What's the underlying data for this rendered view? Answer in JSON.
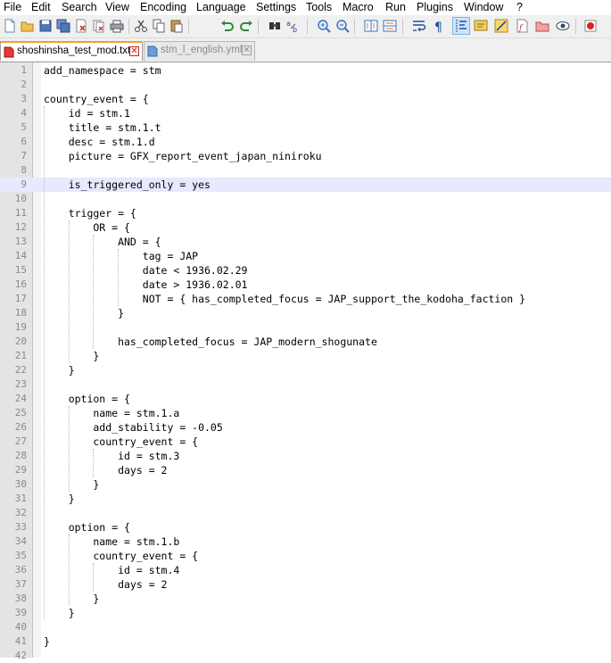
{
  "menu": [
    "File",
    "Edit",
    "Search",
    "View",
    "Encoding",
    "Language",
    "Settings",
    "Tools",
    "Macro",
    "Run",
    "Plugins",
    "Window",
    "?"
  ],
  "toolbar": {
    "buttons": [
      "new-file-icon",
      "open-file-icon",
      "save-icon",
      "save-all-icon",
      "close-icon",
      "close-all-icon",
      "print-icon",
      "cut-icon",
      "copy-icon",
      "paste-icon",
      "undo-icon",
      "redo-icon",
      "find-icon",
      "replace-icon",
      "zoom-in-icon",
      "zoom-out-icon",
      "sync-vertical-icon",
      "sync-horizontal-icon",
      "word-wrap-icon",
      "show-all-characters-icon",
      "indent-guide-icon",
      "user-language-icon",
      "document-map-icon",
      "function-list-icon",
      "folder-as-workspace-icon",
      "monitoring-icon",
      "record-macro-icon"
    ]
  },
  "tabs": [
    {
      "label": "shoshinsha_test_mod.txt",
      "active": true
    },
    {
      "label": "stm_l_english.yml",
      "active": false
    }
  ],
  "editor": {
    "current_line": 9,
    "lines": [
      "add_namespace = stm",
      "",
      "country_event = {",
      "    id = stm.1",
      "    title = stm.1.t",
      "    desc = stm.1.d",
      "    picture = GFX_report_event_japan_niniroku",
      "",
      "    is_triggered_only = yes",
      "",
      "    trigger = {",
      "        OR = {",
      "            AND = {",
      "                tag = JAP",
      "                date < 1936.02.29",
      "                date > 1936.02.01",
      "                NOT = { has_completed_focus = JAP_support_the_kodoha_faction }",
      "            }",
      "",
      "            has_completed_focus = JAP_modern_shogunate",
      "        }",
      "    }",
      "",
      "    option = {",
      "        name = stm.1.a",
      "        add_stability = -0.05",
      "        country_event = {",
      "            id = stm.3",
      "            days = 2",
      "        }",
      "    }",
      "",
      "    option = {",
      "        name = stm.1.b",
      "        country_event = {",
      "            id = stm.4",
      "            days = 2",
      "        }",
      "    }",
      "",
      "}",
      ""
    ]
  },
  "colors": {
    "tab_accent": "#f0a030",
    "current_line": "#e8e8ff",
    "toolbar_active": "#cce4f7"
  }
}
